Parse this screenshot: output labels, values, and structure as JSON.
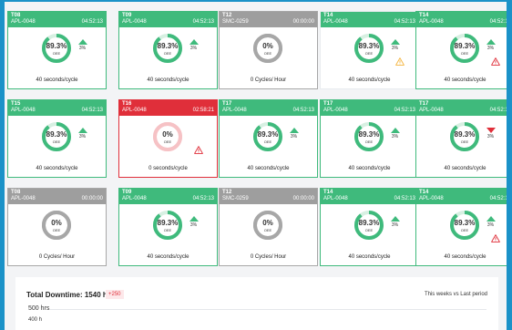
{
  "cards": [
    {
      "title": "T08",
      "asset": "APL-0048",
      "time": "04:52:13",
      "value": "89.3%",
      "oee": "OEE",
      "pct": "3%",
      "direction": "up",
      "warning": "",
      "cycle": "40 seconds/cycle",
      "state": "green"
    },
    {
      "title": "T09",
      "asset": "APL-0048",
      "time": "04:52:13",
      "value": "89.3%",
      "oee": "OEE",
      "pct": "3%",
      "direction": "up",
      "warning": "",
      "cycle": "40 seconds/cycle",
      "state": "green"
    },
    {
      "title": "T12",
      "asset": "SMC-0259",
      "time": "00:00:00",
      "value": "0%",
      "oee": "OEE",
      "pct": "",
      "direction": "none",
      "warning": "",
      "cycle": "0 Cycles/ Hour",
      "state": "gray"
    },
    {
      "title": "T14",
      "asset": "APL-0048",
      "time": "04:52:13",
      "value": "89.3%",
      "oee": "OEE",
      "pct": "3%",
      "direction": "up",
      "warning": "yellow",
      "cycle": "40 seconds/cycle",
      "state": "green-soft"
    },
    {
      "title": "T14",
      "asset": "APL-0048",
      "time": "04:52:13",
      "value": "89.3%",
      "oee": "OEE",
      "pct": "3%",
      "direction": "up",
      "warning": "red",
      "cycle": "40 seconds/cycle",
      "state": "green"
    },
    {
      "title": "T15",
      "asset": "APL-0048",
      "time": "04:52:13",
      "value": "89.3%",
      "oee": "OEE",
      "pct": "3%",
      "direction": "up",
      "warning": "",
      "cycle": "40 seconds/cycle",
      "state": "green"
    },
    {
      "title": "T16",
      "asset": "APL-0048",
      "time": "02:58:21",
      "value": "0%",
      "oee": "OEE",
      "pct": "",
      "direction": "none",
      "warning": "red",
      "cycle": "0 seconds/cycle",
      "state": "red"
    },
    {
      "title": "T17",
      "asset": "APL-0048",
      "time": "04:52:13",
      "value": "89.3%",
      "oee": "OEE",
      "pct": "3%",
      "direction": "up",
      "warning": "",
      "cycle": "40 seconds/cycle",
      "state": "green"
    },
    {
      "title": "T17",
      "asset": "APL-0048",
      "time": "04:52:13",
      "value": "89.3%",
      "oee": "OEE",
      "pct": "3%",
      "direction": "up",
      "warning": "",
      "cycle": "40 seconds/cycle",
      "state": "green"
    },
    {
      "title": "T17",
      "asset": "APL-0048",
      "time": "04:52:13",
      "value": "89.3%",
      "oee": "OEE",
      "pct": "3%",
      "direction": "down",
      "warning": "",
      "cycle": "40 seconds/cycle",
      "state": "green"
    },
    {
      "title": "T08",
      "asset": "APL-0048",
      "time": "00:00:00",
      "value": "0%",
      "oee": "OEE",
      "pct": "",
      "direction": "none",
      "warning": "",
      "cycle": "0 Cycles/ Hour",
      "state": "gray"
    },
    {
      "title": "T09",
      "asset": "APL-0048",
      "time": "04:52:13",
      "value": "89.3%",
      "oee": "OEE",
      "pct": "3%",
      "direction": "up",
      "warning": "",
      "cycle": "40 seconds/cycle",
      "state": "green"
    },
    {
      "title": "T12",
      "asset": "SMC-0259",
      "time": "00:00:00",
      "value": "0%",
      "oee": "OEE",
      "pct": "",
      "direction": "none",
      "warning": "",
      "cycle": "0 Cycles/ Hour",
      "state": "gray"
    },
    {
      "title": "T14",
      "asset": "APL-0048",
      "time": "04:52:13",
      "value": "89.3%",
      "oee": "OEE",
      "pct": "3%",
      "direction": "up",
      "warning": "",
      "cycle": "40 seconds/cycle",
      "state": "green"
    },
    {
      "title": "T14",
      "asset": "APL-0048",
      "time": "04:52:13",
      "value": "89.3%",
      "oee": "OEE",
      "pct": "3%",
      "direction": "up",
      "warning": "red",
      "cycle": "40 seconds/cycle",
      "state": "green"
    }
  ],
  "downtime": {
    "title": "Total Downtime: 1540 hrs",
    "badge": "+250",
    "period": "This weeks vs Last period",
    "y_top": "500 hrs",
    "y_sub": "400 h"
  },
  "colors": {
    "green": "#3fba7c",
    "gray": "#9e9e9e",
    "red": "#e02f3a",
    "warn_yellow": "#f4b43e"
  }
}
